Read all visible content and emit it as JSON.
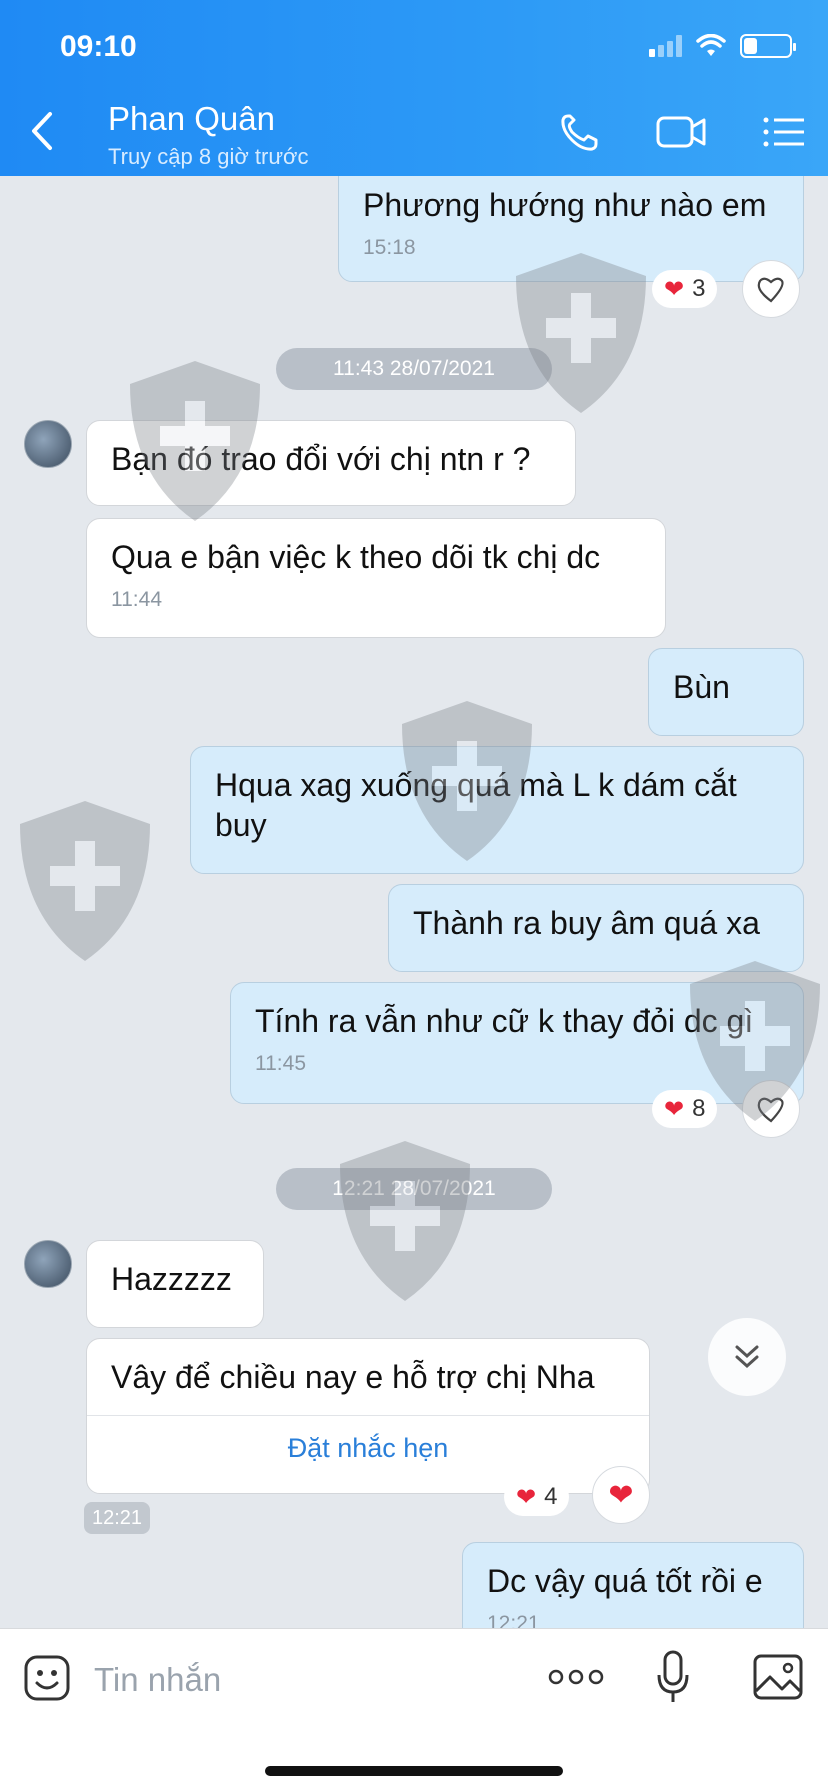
{
  "status_bar": {
    "time": "09:10"
  },
  "header": {
    "contact_name": "Phan Quân",
    "contact_status": "Truy cập 8 giờ trước"
  },
  "messages": {
    "m1": {
      "text": "Phương hướng như nào em",
      "time": "15:18",
      "reaction_count": "3"
    },
    "date1": "11:43 28/07/2021",
    "m2": {
      "text": "Bạn đó trao đổi với chị ntn r ?"
    },
    "m3": {
      "text": "Qua e bận việc k theo dõi tk chị dc",
      "time": "11:44"
    },
    "m4": {
      "text": "Bùn"
    },
    "m5": {
      "text": "Hqua xag xuống quá mà L k dám cắt buy"
    },
    "m6": {
      "text": "Thành ra buy âm quá xa"
    },
    "m7": {
      "text": "Tính ra vẫn như cữ k thay đỏi dc gì",
      "time": "11:45",
      "reaction_count": "8"
    },
    "date2": "12:21 28/07/2021",
    "m8": {
      "text": "Hazzzzz"
    },
    "m9": {
      "text": "Vây để  chiều nay e hỗ trợ chị Nha",
      "action": "Đặt nhắc hẹn",
      "reaction_count": "4",
      "time": "12:21"
    },
    "m10": {
      "text": "Dc vậy quá tốt rồi e",
      "time": "12:21"
    }
  },
  "input": {
    "placeholder": "Tin nhắn"
  },
  "icons": [
    "back-icon",
    "phone-icon",
    "video-icon",
    "menu-icon",
    "sticker-icon",
    "more-icon",
    "mic-icon",
    "image-icon",
    "heart-icon",
    "like-icon",
    "chevron-double-down-icon"
  ],
  "colors": {
    "header": "#2d9af6",
    "outgoing_bubble": "#d6ecfb",
    "incoming_bubble": "#ffffff",
    "heart": "#e8253b",
    "link": "#2a7fd9"
  }
}
